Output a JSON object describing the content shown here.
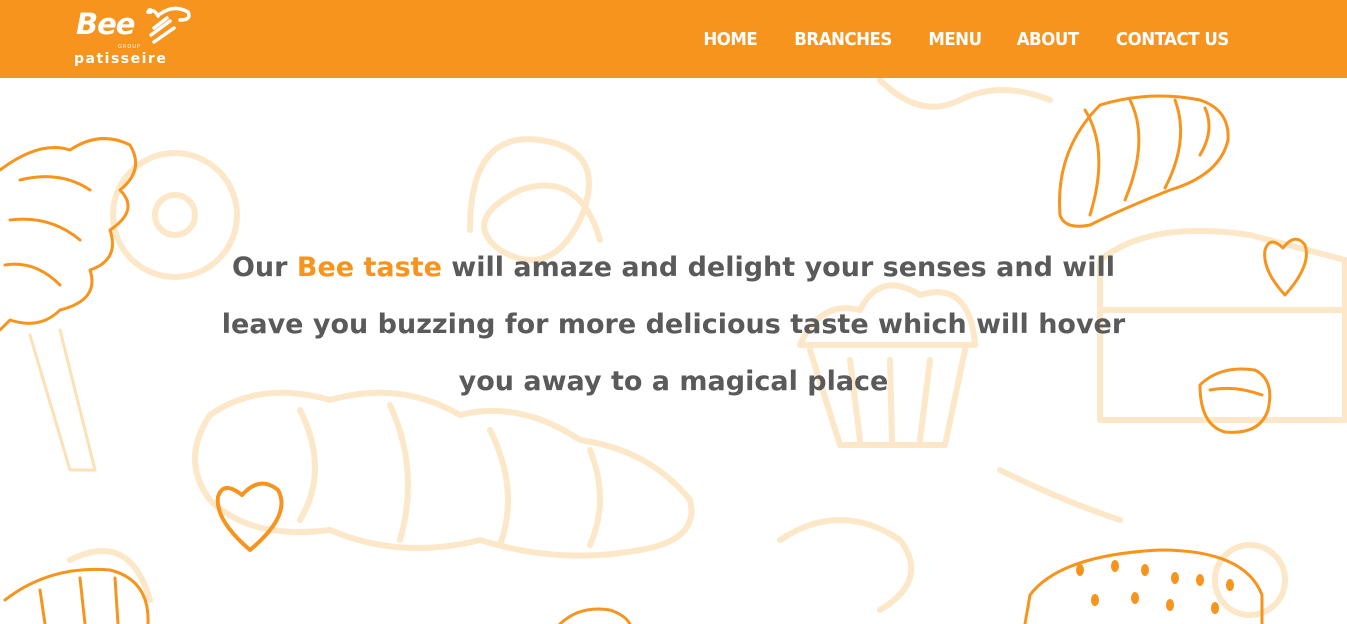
{
  "brand": {
    "name": "Bee",
    "group": "GROUP",
    "tagline": "patisseire"
  },
  "nav": {
    "items": [
      {
        "label": "HOME"
      },
      {
        "label": "BRANCHES"
      },
      {
        "label": "MENU"
      },
      {
        "label": "ABOUT"
      },
      {
        "label": "CONTACT US"
      }
    ]
  },
  "hero": {
    "text_before": "Our ",
    "highlight": "Bee taste",
    "text_after": " will amaze and delight your senses and will leave you buzzing for more delicious taste which will hover you away to a magical place"
  },
  "colors": {
    "brand_orange": "#f7941e",
    "text_gray": "#5a5a5a",
    "illustration_faint": "#fce8c8"
  },
  "icons": [
    "bee-logo-icon",
    "ice-cream-illustration",
    "croissant-illustration",
    "heart-illustration",
    "bread-illustration",
    "cake-illustration",
    "cupcake-illustration",
    "donut-illustration",
    "pretzel-illustration"
  ]
}
